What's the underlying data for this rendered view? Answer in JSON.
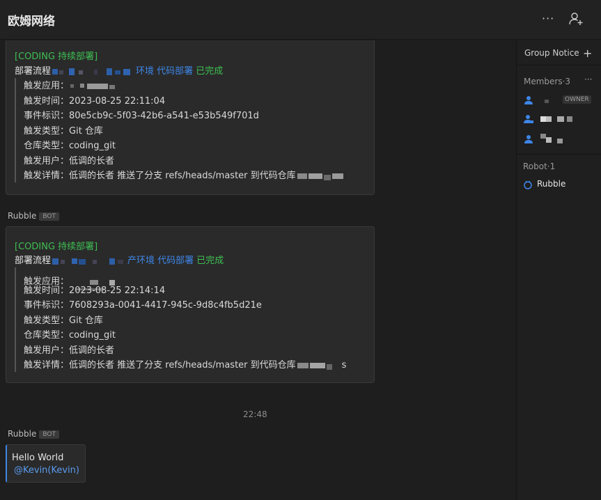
{
  "header": {
    "group_name": "欧姆网络",
    "more_glyph": "···"
  },
  "messages": [
    {
      "card_title": "[CODING 持续部署]",
      "flow_prefix": "部署流程",
      "flow_env": "环境 代码部署",
      "flow_status": "已完成",
      "rows": [
        {
          "label": "触发应用：",
          "value": ""
        },
        {
          "label": "触发时间：",
          "value": "2023-08-25 22:11:04"
        },
        {
          "label": "事件标识：",
          "value": "80e5cb9c-5f03-42b6-a541-e53b549f701d"
        },
        {
          "label": "触发类型：",
          "value": "Git 仓库"
        },
        {
          "label": "仓库类型：",
          "value": "coding_git"
        },
        {
          "label": "触发用户：",
          "value": "低调的长者"
        },
        {
          "label": "触发详情：",
          "value": "低调的长者 推送了分支 refs/heads/master 到代码仓库"
        }
      ]
    },
    {
      "sender": "Rubble",
      "badge": "BOT",
      "card_title": "[CODING 持续部署]",
      "flow_prefix": "部署流程",
      "flow_env": "产环境 代码部署",
      "flow_status": "已完成",
      "rows": [
        {
          "label": "触发应用：",
          "value": ""
        },
        {
          "label": "触发时间：",
          "value": "2023-08-25 22:14:14"
        },
        {
          "label": "事件标识：",
          "value": "7608293a-0041-4417-945c-9d8c4fb5d21e"
        },
        {
          "label": "触发类型：",
          "value": "Git 仓库"
        },
        {
          "label": "仓库类型：",
          "value": "coding_git"
        },
        {
          "label": "触发用户：",
          "value": "低调的长者"
        },
        {
          "label": "触发详情：",
          "value": "低调的长者 推送了分支 refs/heads/master 到代码仓库",
          "suffix": "s"
        }
      ]
    },
    {
      "time_separator": "22:48",
      "sender": "Rubble",
      "badge": "BOT",
      "text": "Hello World",
      "mention": "@Kevin(Kevin)"
    }
  ],
  "sidebar": {
    "group_notice": "Group Notice",
    "add_glyph": "+",
    "members_label": "Members·3",
    "more_glyph": "···",
    "owner_badge": "OWNER",
    "robot_label": "Robot·1",
    "robot_name": "Rubble"
  },
  "colors": {
    "background": "#1e1e1e",
    "card": "#2a2a2a",
    "success_green": "#3fbf52",
    "link_blue": "#3e86e8",
    "mention_blue": "#5a9cf0"
  }
}
